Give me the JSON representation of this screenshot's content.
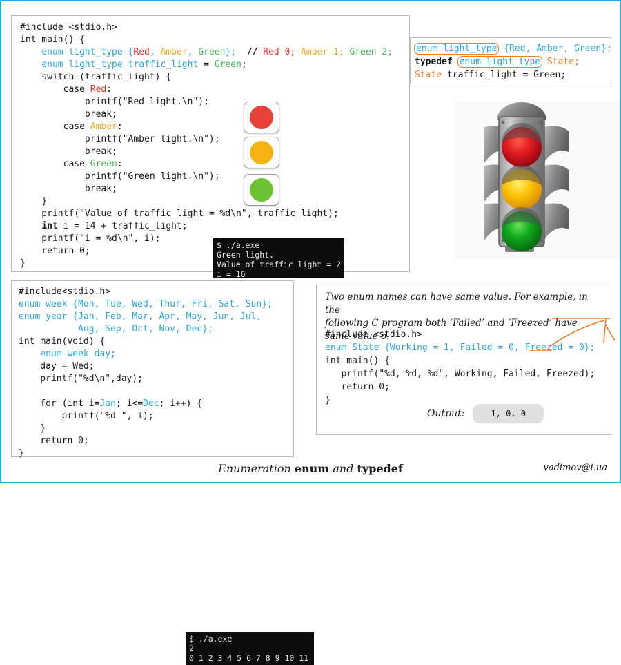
{
  "slide": {
    "caption_prefix": "Enumeration ",
    "caption_kw1": "enum",
    "caption_mid": " and ",
    "caption_kw2": "typedef",
    "credit": "vadimov@i.ua",
    "frame_color": "#29a8e0"
  },
  "panel_switch": {
    "title": "traffic-light-switch-example",
    "lines": [
      "#include <stdio.h>",
      "int main() {",
      "    enum light_type {Red, Amber, Green};  // Red 0; Amber 1; Green 2;",
      "    enum light_type traffic_light = Green;",
      "    switch (traffic_light) {",
      "        case Red:",
      "            printf(\"Red light.\\n\");",
      "            break;",
      "        case Amber:",
      "            printf(\"Amber light.\\n\");",
      "            break;",
      "        case Green:",
      "            printf(\"Green light.\\n\");",
      "            break;",
      "    }",
      "    printf(\"Value of traffic_light = %d\\n\", traffic_light);",
      "    int i = 14 + traffic_light;",
      "    printf(\"i = %d\\n\", i);",
      "    return 0;",
      "}"
    ],
    "terminal": "$ ./a.exe\nGreen light.\nValue of traffic_light = 2\ni = 16",
    "chips": [
      {
        "name": "red-light-chip",
        "color": "#e8413a"
      },
      {
        "name": "amber-light-chip",
        "color": "#f5b312"
      },
      {
        "name": "green-light-chip",
        "color": "#6cc231"
      }
    ]
  },
  "panel_typedef": {
    "line1_a": "enum light_type",
    "line1_b": " {Red, Amber, Green};",
    "line2_a": "typedef",
    "line2_b": "enum light_type",
    "line2_c": " State;",
    "line3_a": "State",
    "line3_b": " traffic_light = Green;"
  },
  "panel_week": {
    "lines": [
      "#include<stdio.h>",
      "enum week {Mon, Tue, Wed, Thur, Fri, Sat, Sun};",
      "enum year {Jan, Feb, Mar, Apr, May, Jun, Jul,",
      "           Aug, Sep, Oct, Nov, Dec};",
      "int main(void) {",
      "    enum week day;",
      "    day = Wed;",
      "    printf(\"%d\\n\",day);",
      "",
      "    for (int i=Jan; i<=Dec; i++) {",
      "        printf(\"%d \", i);",
      "    }",
      "    return 0;",
      "}"
    ],
    "terminal": "$ ./a.exe\n2\n0 1 2 3 4 5 6 7 8 9 10 11"
  },
  "panel_samevalue": {
    "note_line1": "Two enum names can have same value. For example, in the",
    "note_line2": "following C program both ‘Failed’ and ‘Freezed’ have same value o.",
    "lines": [
      "#include <stdio.h>",
      "enum State {Working = 1, Failed = 0, Freezed = 0};",
      "int main() {",
      "   printf(\"%d, %d, %d\", Working, Failed, Freezed);",
      "   return 0;",
      "}"
    ],
    "output_label": "Output:",
    "output_value": "1, 0, 0",
    "annotation_color": "#f07d28"
  },
  "traffic_light_image": {
    "name": "traffic-light-illustration",
    "red": "#d8172a",
    "amber": "#fcc80a",
    "green": "#14a820",
    "body": "#8c8c8c"
  }
}
